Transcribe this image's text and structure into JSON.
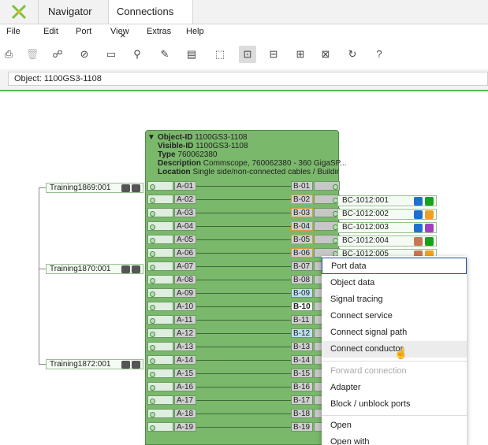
{
  "tabs": [
    {
      "label": "Navigator"
    },
    {
      "label": "Connections",
      "close": "×"
    }
  ],
  "menu": [
    "File",
    "Edit",
    "Port",
    "View",
    "Extras",
    "Help"
  ],
  "toolbar_icons": [
    "print-icon",
    "delete-icon",
    "network-icon",
    "check-circle-icon",
    "connector-icon",
    "search-link-icon",
    "edit-line-icon",
    "clipboard-icon",
    "cable-select-icon",
    "device-icon",
    "device-export-icon",
    "device-arrow-icon",
    "device-node-icon",
    "refresh-icon",
    "help-icon"
  ],
  "object_field": "Object: 1100GS3-1108",
  "object_info": {
    "object_id_label": "Object-ID",
    "object_id": "1100GS3-1108",
    "visible_id_label": "Visible-ID",
    "visible_id": "1100GS3-1108",
    "type_label": "Type",
    "type": "760062380",
    "description_label": "Description",
    "description": "Commscope, 760062380 - 360 GigaSP...",
    "location_label": "Location",
    "location": "Single side/non-connected cables / Building"
  },
  "ports_a": [
    "A-01",
    "A-02",
    "A-03",
    "A-04",
    "A-05",
    "A-06",
    "A-07",
    "A-08",
    "A-09",
    "A-10",
    "A-11",
    "A-12",
    "A-13",
    "A-14",
    "A-15",
    "A-16",
    "A-17",
    "A-18",
    "A-19"
  ],
  "ports_b": [
    "B-01",
    "B-02",
    "B-03",
    "B-04",
    "B-05",
    "B-06",
    "B-07",
    "B-08",
    "B-09",
    "B-10",
    "B-11",
    "B-12",
    "B-13",
    "B-14",
    "B-15",
    "B-16",
    "B-17",
    "B-18",
    "B-19"
  ],
  "trainings": [
    "Training1869:001",
    "Training1870:001",
    "Training1872:001"
  ],
  "bc_cables": [
    "BC-1012:001",
    "BC-1012:002",
    "BC-1012:003",
    "BC-1012:004",
    "BC-1012:005"
  ],
  "bc_colors": [
    [
      "#1f6fd0",
      "#17a317"
    ],
    [
      "#1f6fd0",
      "#f0a020"
    ],
    [
      "#1f6fd0",
      "#a040c0"
    ],
    [
      "#c87850",
      "#17a317"
    ],
    [
      "#c87850",
      "#f0a020"
    ]
  ],
  "context_menu": [
    "Port data",
    "Object data",
    "Signal tracing",
    "Connect service",
    "Connect signal path",
    "Connect conductor",
    "Forward connection",
    "Adapter",
    "Block / unblock ports",
    "Open",
    "Open with"
  ]
}
